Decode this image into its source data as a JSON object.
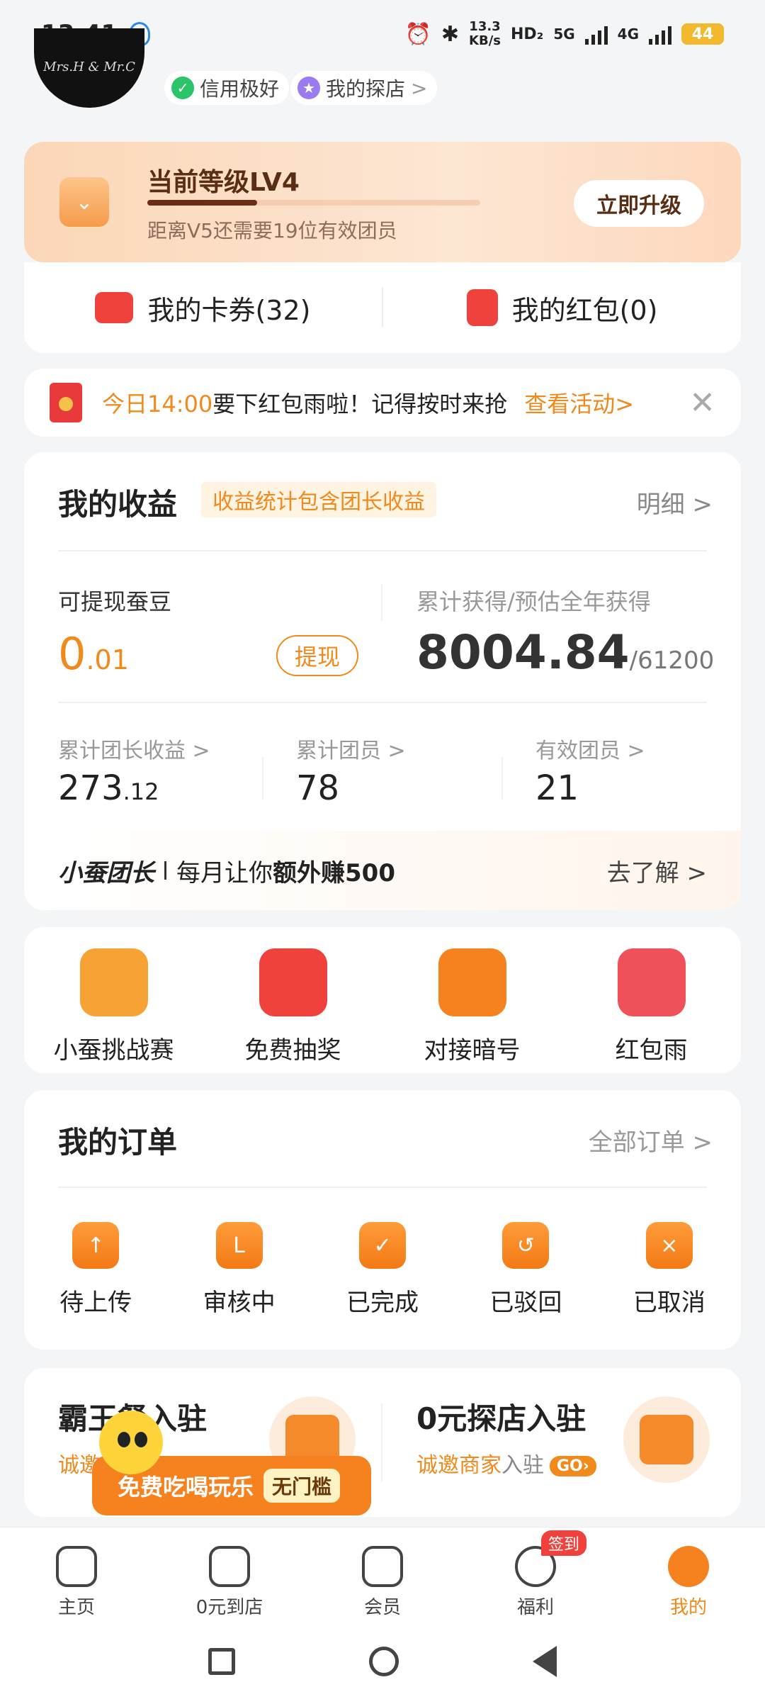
{
  "status": {
    "time": "13:41",
    "net_speed": "13.3",
    "net_unit": "KB/s",
    "hd": "HD₂",
    "g5": "5G",
    "g4": "4G",
    "battery": "44"
  },
  "profile": {
    "avatar_text": "Mrs.H & Mr.C",
    "credit": "信用极好",
    "explore": "我的探店",
    "explore_chevron": ">"
  },
  "level": {
    "title": "当前等级LV4",
    "progress": 0.33,
    "subtitle": "距离V5还需要19位有效团员",
    "upgrade": "立即升级"
  },
  "coupons": {
    "cards": "我的卡券(32)",
    "redpacket": "我的红包(0)"
  },
  "notice": {
    "time": "今日14:00",
    "text": "要下红包雨啦！记得按时来抢",
    "link": "查看活动>",
    "close": "✕"
  },
  "earnings": {
    "title": "我的收益",
    "tag": "收益统计包含团长收益",
    "detail": "明细 >",
    "withdraw_label": "可提现蚕豆",
    "withdraw_int": "0",
    "withdraw_dec": ".01",
    "withdraw_btn": "提现",
    "total_label": "累计获得/预估全年获得",
    "total_value": "8004.84",
    "total_est": "/61200",
    "stats": [
      {
        "label": "累计团长收益 >",
        "int": "273",
        "dec": ".12"
      },
      {
        "label": "累计团员 >",
        "int": "78",
        "dec": ""
      },
      {
        "label": "有效团员 >",
        "int": "21",
        "dec": ""
      }
    ],
    "leader_brand": "小蚕团长",
    "leader_text_1": "每月让你",
    "leader_text_2": "额外赚500",
    "leader_more": "去了解 >"
  },
  "features": [
    {
      "label": "小蚕挑战赛",
      "icon": "trophy-icon",
      "color": "#f7a234"
    },
    {
      "label": "免费抽奖",
      "icon": "gift-box-icon",
      "color": "#f0423c"
    },
    {
      "label": "对接暗号",
      "icon": "key-icon",
      "color": "#f5821f"
    },
    {
      "label": "红包雨",
      "icon": "red-envelope-icon",
      "color": "#f0505a"
    }
  ],
  "orders": {
    "title": "我的订单",
    "all": "全部订单 >",
    "items": [
      {
        "label": "待上传",
        "glyph": "↑"
      },
      {
        "label": "审核中",
        "glyph": "L"
      },
      {
        "label": "已完成",
        "glyph": "✓"
      },
      {
        "label": "已驳回",
        "glyph": "↺"
      },
      {
        "label": "已取消",
        "glyph": "×"
      }
    ]
  },
  "merchant": {
    "left_title": "霸王餐入驻",
    "left_sub": "诚邀",
    "right_title": "0元探店入驻",
    "right_sub_1": "诚邀商家",
    "right_sub_2": "入驻",
    "go": "GO›"
  },
  "float_banner": {
    "text": "免费吃喝玩乐",
    "tag": "无门槛"
  },
  "tabs": [
    {
      "label": "主页"
    },
    {
      "label": "0元到店"
    },
    {
      "label": "会员"
    },
    {
      "label": "福利",
      "badge": "签到"
    },
    {
      "label": "我的"
    }
  ]
}
